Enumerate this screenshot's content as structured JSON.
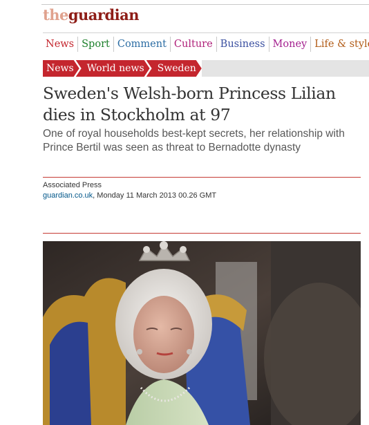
{
  "masthead": {
    "logo_the": "the",
    "logo_name": "guardian"
  },
  "nav": {
    "items": [
      {
        "label": "News",
        "color": "#c4262e"
      },
      {
        "label": "Sport",
        "color": "#1b7f2a"
      },
      {
        "label": "Comment",
        "color": "#2b6ca3"
      },
      {
        "label": "Culture",
        "color": "#b0217a"
      },
      {
        "label": "Business",
        "color": "#3a4fa0"
      },
      {
        "label": "Money",
        "color": "#a4208f"
      },
      {
        "label": "Life & style",
        "color": "#b15b16"
      }
    ]
  },
  "breadcrumb": [
    "News",
    "World news",
    "Sweden"
  ],
  "article": {
    "headline": "Sweden's Welsh-born Princess Lilian dies in Stockholm at 97",
    "standfirst": "One of royal households best-kept secrets, her relationship with Prince Bertil was seen as threat to Bernadotte dynasty",
    "byline": "Associated Press",
    "source_link": "guardian.co.uk",
    "dateline": ", Monday 11 March 2013 00.26 GMT"
  },
  "colors": {
    "accent": "#c4262e",
    "brand": "#8e1d17"
  }
}
